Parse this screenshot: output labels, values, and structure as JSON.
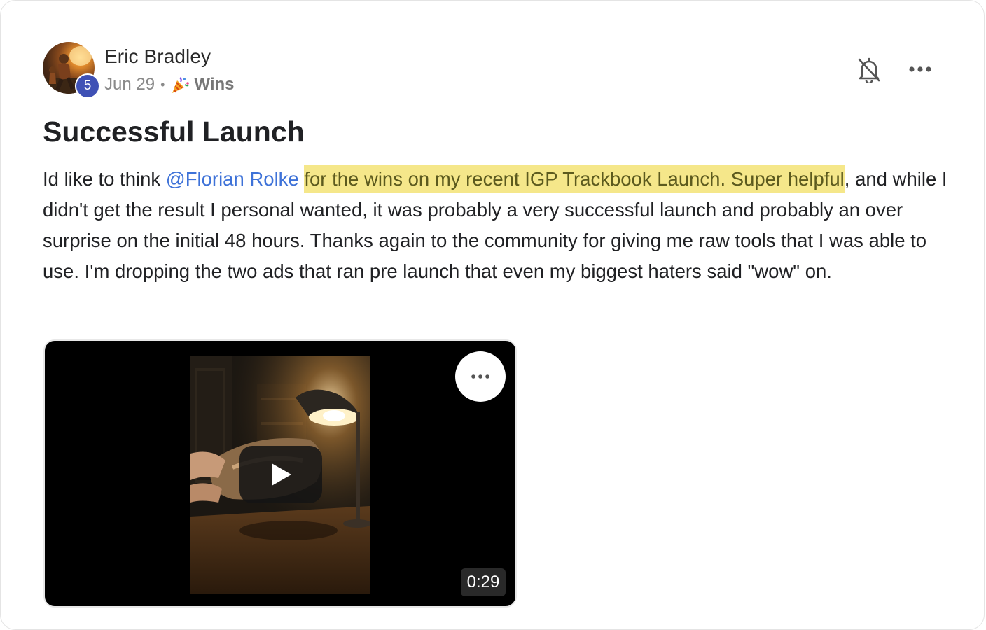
{
  "post": {
    "author": {
      "name": "Eric Bradley",
      "level": "5"
    },
    "date": "Jun 29",
    "separator": "•",
    "category": {
      "icon": "party-popper-icon",
      "label": "Wins"
    },
    "title": "Successful Launch",
    "body": {
      "intro": "Id like to think ",
      "mention": "@Florian Rolke",
      "space": " ",
      "highlight": "for the wins on my recent IGP Trackbook Launch. Super helpful",
      "rest": ", and while I didn't get the result I personal wanted, it was probably a very successful launch and probably an over surprise on the initial 48 hours. Thanks again to the community for giving me raw tools that I was able to use. I'm dropping the two ads that ran pre launch that even my biggest haters said \"wow\" on."
    },
    "video": {
      "duration": "0:29",
      "play_icon": "play-icon",
      "more_icon": "more-horizontal-icon"
    },
    "actions": {
      "bell_icon": "bell-off-icon",
      "more_icon": "more-horizontal-icon"
    }
  },
  "colors": {
    "mention": "#3e72d8",
    "highlight_bg": "#f5e78a",
    "level_badge": "#3f51b5"
  }
}
